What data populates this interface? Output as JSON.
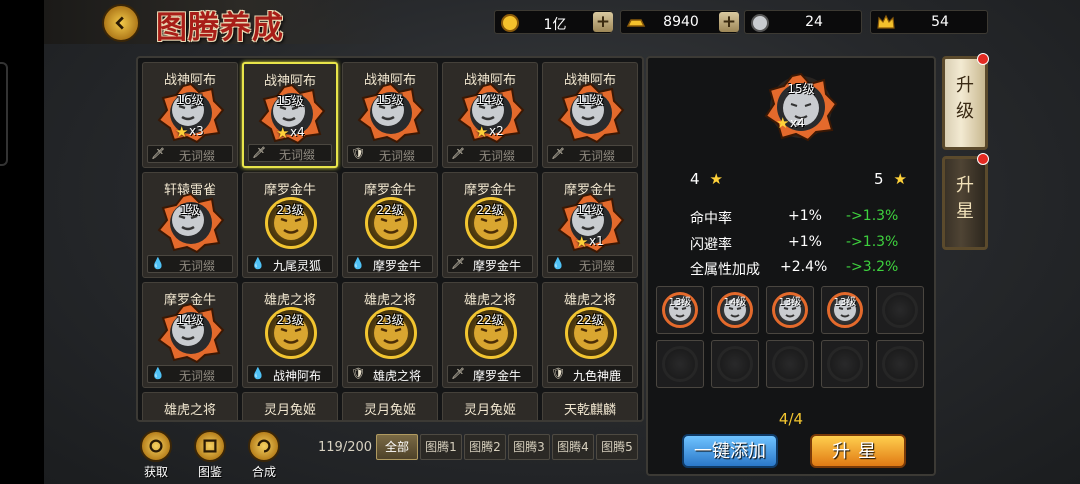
{
  "title": "图腾养成",
  "resources": [
    {
      "icon": "gold-coin-icon",
      "value": "1亿",
      "plus": "+"
    },
    {
      "icon": "gold-ingot-icon",
      "value": "8940",
      "plus": "+"
    },
    {
      "icon": "totem-material-icon",
      "value": "24"
    },
    {
      "icon": "crown-token-icon",
      "value": "54"
    }
  ],
  "grid": [
    {
      "name": "战神阿布",
      "level": "16级",
      "stars": "x3",
      "tag": "无词缀",
      "tagicon": "sword"
    },
    {
      "name": "战神阿布",
      "level": "15级",
      "stars": "x4",
      "tag": "无词缀",
      "tagicon": "sword",
      "selected": true
    },
    {
      "name": "战神阿布",
      "level": "15级",
      "stars": "",
      "tag": "无词缀",
      "tagicon": "shield"
    },
    {
      "name": "战神阿布",
      "level": "14级",
      "stars": "x2",
      "tag": "无词缀",
      "tagicon": "sword"
    },
    {
      "name": "战神阿布",
      "level": "11级",
      "stars": "",
      "tag": "无词缀",
      "tagicon": "sword"
    },
    {
      "name": "轩辕雷雀",
      "level": "1级",
      "stars": "",
      "tag": "无词缀",
      "tagicon": "blood"
    },
    {
      "name": "摩罗金牛",
      "level": "23级",
      "stars": "",
      "tag": "九尾灵狐",
      "tagicon": "blood",
      "gold": true
    },
    {
      "name": "摩罗金牛",
      "level": "22级",
      "stars": "",
      "tag": "摩罗金牛",
      "tagicon": "blood",
      "gold": true
    },
    {
      "name": "摩罗金牛",
      "level": "22级",
      "stars": "",
      "tag": "摩罗金牛",
      "tagicon": "sword",
      "gold": true
    },
    {
      "name": "摩罗金牛",
      "level": "14级",
      "stars": "x1",
      "tag": "无词缀",
      "tagicon": "blood"
    },
    {
      "name": "摩罗金牛",
      "level": "14级",
      "stars": "",
      "tag": "无词缀",
      "tagicon": "blood"
    },
    {
      "name": "雄虎之将",
      "level": "23级",
      "stars": "",
      "tag": "战神阿布",
      "tagicon": "blood",
      "gold": true
    },
    {
      "name": "雄虎之将",
      "level": "23级",
      "stars": "",
      "tag": "雄虎之将",
      "tagicon": "shield",
      "gold": true
    },
    {
      "name": "雄虎之将",
      "level": "22级",
      "stars": "",
      "tag": "摩罗金牛",
      "tagicon": "sword",
      "gold": true
    },
    {
      "name": "雄虎之将",
      "level": "22级",
      "stars": "",
      "tag": "九色神鹿",
      "tagicon": "shield",
      "gold": true
    },
    {
      "name": "雄虎之将"
    },
    {
      "name": "灵月兔姬"
    },
    {
      "name": "灵月兔姬"
    },
    {
      "name": "灵月兔姬"
    },
    {
      "name": "天乾麒麟"
    }
  ],
  "bottom": {
    "actions": [
      "获取",
      "图鉴",
      "合成"
    ],
    "count": "119/200",
    "tabs": [
      "全部",
      "图腾1",
      "图腾2",
      "图腾3",
      "图腾4",
      "图腾5"
    ]
  },
  "detail": {
    "token": {
      "level": "15级",
      "stars": "x4"
    },
    "star_from": "4",
    "star_to": "5",
    "stats": [
      {
        "name": "命中率",
        "value": "+1%",
        "next": "->1.3%"
      },
      {
        "name": "闪避率",
        "value": "+1%",
        "next": "->1.3%"
      },
      {
        "name": "全属性加成",
        "value": "+2.4%",
        "next": "->3.2%"
      }
    ],
    "materials": [
      "13级",
      "14级",
      "13级",
      "13级"
    ],
    "progress": "4/4",
    "btn_add": "一键添加",
    "btn_star": "升星"
  },
  "side_tabs": [
    "升级",
    "升星"
  ],
  "colors": {
    "accent": "#f2c530",
    "green": "#3ed13e",
    "orange_ring": "#e46a2c"
  }
}
